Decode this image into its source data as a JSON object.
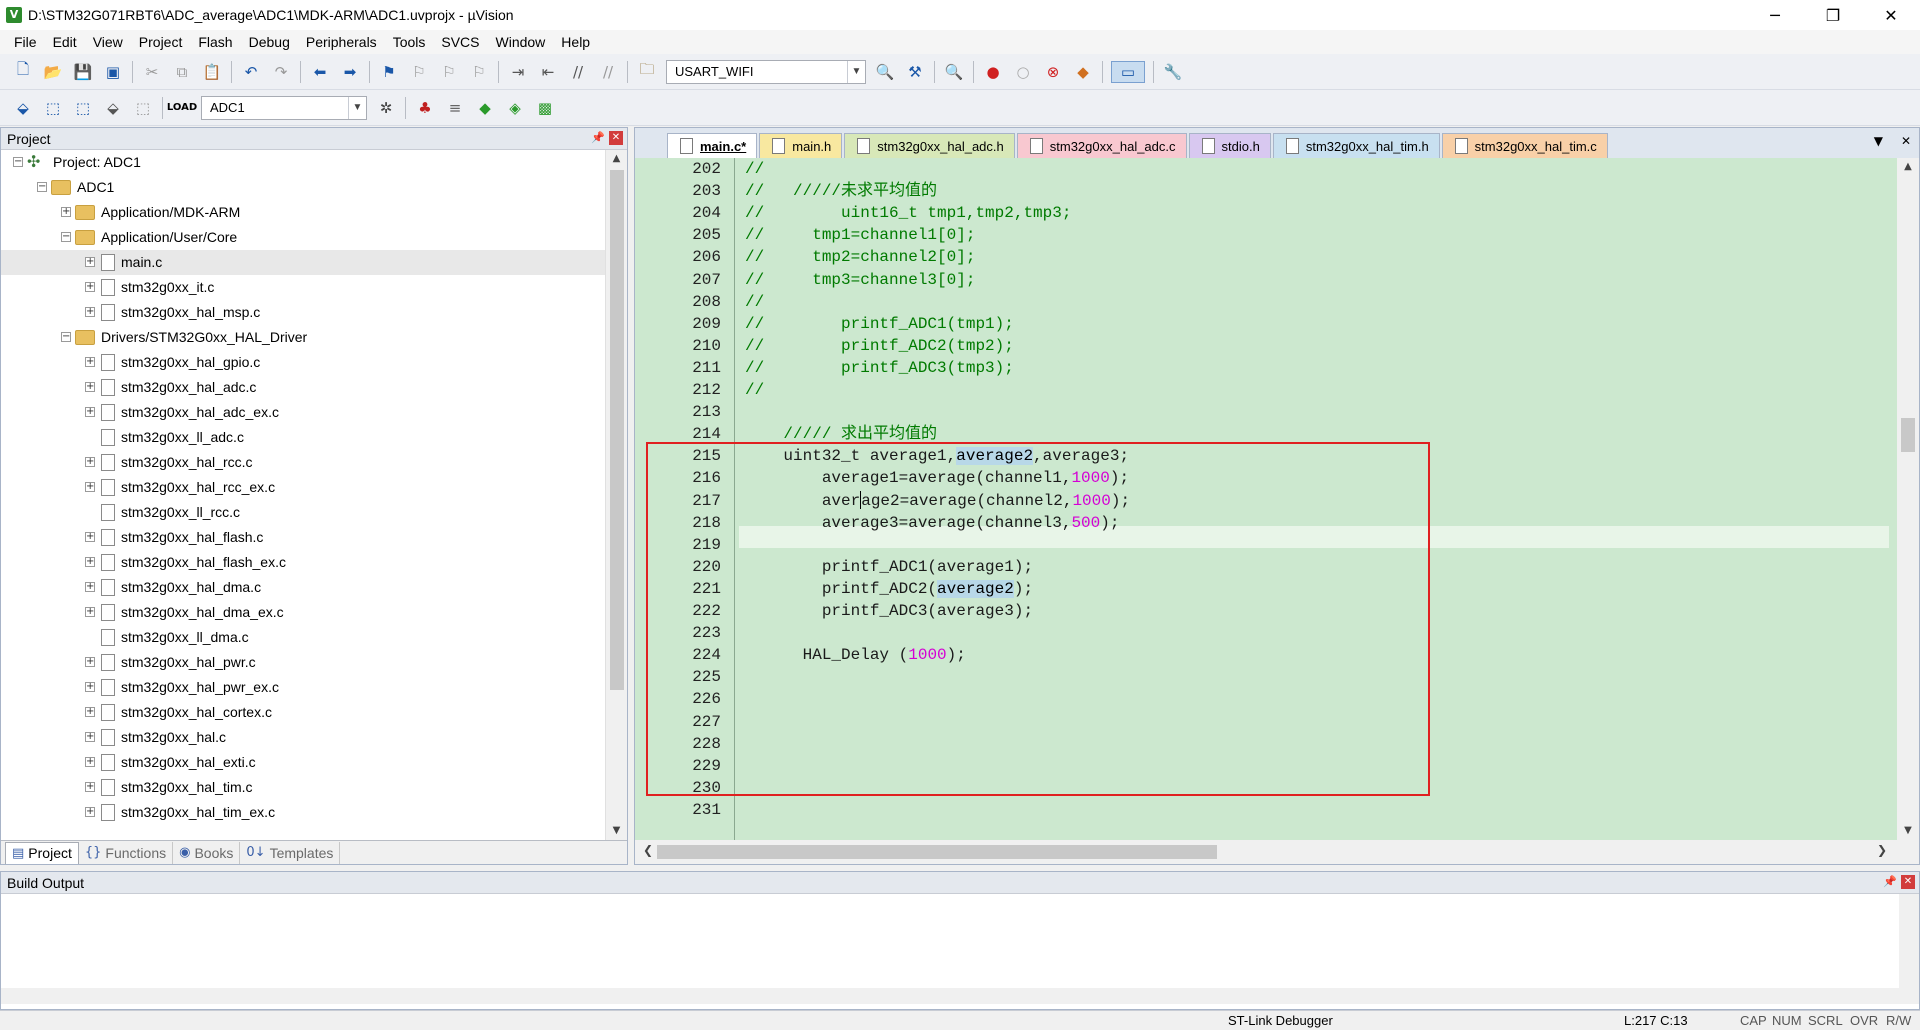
{
  "window": {
    "title": "D:\\STM32G071RBT6\\ADC_average\\ADC1\\MDK-ARM\\ADC1.uvprojx - µVision",
    "app_icon": "V"
  },
  "menu": [
    "File",
    "Edit",
    "View",
    "Project",
    "Flash",
    "Debug",
    "Peripherals",
    "Tools",
    "SVCS",
    "Window",
    "Help"
  ],
  "toolbar": {
    "find_combo": "USART_WIFI",
    "target_combo": "ADC1"
  },
  "project_panel": {
    "title": "Project",
    "tree": [
      {
        "label": "Project: ADC1",
        "level": 0,
        "type": "project",
        "expander": "−"
      },
      {
        "label": "ADC1",
        "level": 1,
        "type": "folder",
        "expander": "−"
      },
      {
        "label": "Application/MDK-ARM",
        "level": 2,
        "type": "folder",
        "expander": "+"
      },
      {
        "label": "Application/User/Core",
        "level": 2,
        "type": "folder",
        "expander": "−"
      },
      {
        "label": "main.c",
        "level": 3,
        "type": "file",
        "expander": "+",
        "selected": true
      },
      {
        "label": "stm32g0xx_it.c",
        "level": 3,
        "type": "file",
        "expander": "+"
      },
      {
        "label": "stm32g0xx_hal_msp.c",
        "level": 3,
        "type": "file",
        "expander": "+"
      },
      {
        "label": "Drivers/STM32G0xx_HAL_Driver",
        "level": 2,
        "type": "folder",
        "expander": "−"
      },
      {
        "label": "stm32g0xx_hal_gpio.c",
        "level": 3,
        "type": "file",
        "expander": "+"
      },
      {
        "label": "stm32g0xx_hal_adc.c",
        "level": 3,
        "type": "file",
        "expander": "+"
      },
      {
        "label": "stm32g0xx_hal_adc_ex.c",
        "level": 3,
        "type": "file",
        "expander": "+"
      },
      {
        "label": "stm32g0xx_ll_adc.c",
        "level": 3,
        "type": "file",
        "expander": ""
      },
      {
        "label": "stm32g0xx_hal_rcc.c",
        "level": 3,
        "type": "file",
        "expander": "+"
      },
      {
        "label": "stm32g0xx_hal_rcc_ex.c",
        "level": 3,
        "type": "file",
        "expander": "+"
      },
      {
        "label": "stm32g0xx_ll_rcc.c",
        "level": 3,
        "type": "file",
        "expander": ""
      },
      {
        "label": "stm32g0xx_hal_flash.c",
        "level": 3,
        "type": "file",
        "expander": "+"
      },
      {
        "label": "stm32g0xx_hal_flash_ex.c",
        "level": 3,
        "type": "file",
        "expander": "+"
      },
      {
        "label": "stm32g0xx_hal_dma.c",
        "level": 3,
        "type": "file",
        "expander": "+"
      },
      {
        "label": "stm32g0xx_hal_dma_ex.c",
        "level": 3,
        "type": "file",
        "expander": "+"
      },
      {
        "label": "stm32g0xx_ll_dma.c",
        "level": 3,
        "type": "file",
        "expander": ""
      },
      {
        "label": "stm32g0xx_hal_pwr.c",
        "level": 3,
        "type": "file",
        "expander": "+"
      },
      {
        "label": "stm32g0xx_hal_pwr_ex.c",
        "level": 3,
        "type": "file",
        "expander": "+"
      },
      {
        "label": "stm32g0xx_hal_cortex.c",
        "level": 3,
        "type": "file",
        "expander": "+"
      },
      {
        "label": "stm32g0xx_hal.c",
        "level": 3,
        "type": "file",
        "expander": "+"
      },
      {
        "label": "stm32g0xx_hal_exti.c",
        "level": 3,
        "type": "file",
        "expander": "+"
      },
      {
        "label": "stm32g0xx_hal_tim.c",
        "level": 3,
        "type": "file",
        "expander": "+"
      },
      {
        "label": "stm32g0xx_hal_tim_ex.c",
        "level": 3,
        "type": "file",
        "expander": "+"
      }
    ],
    "tabs": [
      {
        "label": "Project",
        "icon": "▤",
        "active": true
      },
      {
        "label": "Functions",
        "icon": "{}",
        "active": false
      },
      {
        "label": "Books",
        "icon": "◉",
        "active": false
      },
      {
        "label": "Templates",
        "icon": "0↓",
        "active": false
      }
    ]
  },
  "editor": {
    "tabs": [
      {
        "label": "main.c*",
        "active": true,
        "color": "#ffffff"
      },
      {
        "label": "main.h",
        "active": false,
        "color": "#f8e8a0"
      },
      {
        "label": "stm32g0xx_hal_adc.h",
        "active": false,
        "color": "#d8e8b8"
      },
      {
        "label": "stm32g0xx_hal_adc.c",
        "active": false,
        "color": "#f8c8d0"
      },
      {
        "label": "stdio.h",
        "active": false,
        "color": "#d8c8f0"
      },
      {
        "label": "stm32g0xx_hal_tim.h",
        "active": false,
        "color": "#c8e0f0"
      },
      {
        "label": "stm32g0xx_hal_tim.c",
        "active": false,
        "color": "#f8d0a8"
      }
    ],
    "lines": [
      {
        "n": "202",
        "segs": [
          [
            "cmt",
            "//"
          ]
        ]
      },
      {
        "n": "203",
        "segs": [
          [
            "cmt",
            "//   /////未求平均值的"
          ]
        ]
      },
      {
        "n": "204",
        "segs": [
          [
            "cmt",
            "//        uint16_t tmp1,tmp2,tmp3;"
          ]
        ]
      },
      {
        "n": "205",
        "segs": [
          [
            "cmt",
            "//     tmp1=channel1[0];"
          ]
        ]
      },
      {
        "n": "206",
        "segs": [
          [
            "cmt",
            "//     tmp2=channel2[0];"
          ]
        ]
      },
      {
        "n": "207",
        "segs": [
          [
            "cmt",
            "//     tmp3=channel3[0];"
          ]
        ]
      },
      {
        "n": "208",
        "segs": [
          [
            "cmt",
            "//"
          ]
        ]
      },
      {
        "n": "209",
        "segs": [
          [
            "cmt",
            "//        printf_ADC1(tmp1);"
          ]
        ]
      },
      {
        "n": "210",
        "segs": [
          [
            "cmt",
            "//        printf_ADC2(tmp2);"
          ]
        ]
      },
      {
        "n": "211",
        "segs": [
          [
            "cmt",
            "//        printf_ADC3(tmp3);"
          ]
        ]
      },
      {
        "n": "212",
        "segs": [
          [
            "cmt",
            "//"
          ]
        ]
      },
      {
        "n": "213",
        "segs": []
      },
      {
        "n": "214",
        "segs": [
          [
            "cmt",
            "    ///// 求出平均值的"
          ]
        ]
      },
      {
        "n": "215",
        "segs": [
          [
            "code",
            "    uint32_t average1,"
          ],
          [
            "hl",
            "average2"
          ],
          [
            "code",
            ",average3;"
          ]
        ]
      },
      {
        "n": "216",
        "segs": [
          [
            "code",
            "        average1=average(channel1,"
          ],
          [
            "num",
            "1000"
          ],
          [
            "code",
            ");"
          ]
        ]
      },
      {
        "n": "217",
        "segs": [
          [
            "code",
            "        aver"
          ],
          [
            "caret",
            ""
          ],
          [
            "code",
            "age2=average(channel2,"
          ],
          [
            "num",
            "1000"
          ],
          [
            "code",
            ");"
          ]
        ]
      },
      {
        "n": "218",
        "segs": [
          [
            "code",
            "        average3=average(channel3,"
          ],
          [
            "num",
            "500"
          ],
          [
            "code",
            ");"
          ]
        ]
      },
      {
        "n": "219",
        "segs": []
      },
      {
        "n": "220",
        "segs": [
          [
            "code",
            "        printf_ADC1(average1);"
          ]
        ]
      },
      {
        "n": "221",
        "segs": [
          [
            "code",
            "        printf_ADC2("
          ],
          [
            "hl",
            "average2"
          ],
          [
            "code",
            ");"
          ]
        ]
      },
      {
        "n": "222",
        "segs": [
          [
            "code",
            "        printf_ADC3(average3);"
          ]
        ]
      },
      {
        "n": "223",
        "segs": []
      },
      {
        "n": "224",
        "segs": [
          [
            "code",
            "      HAL_Delay ("
          ],
          [
            "num",
            "1000"
          ],
          [
            "code",
            ");"
          ]
        ]
      },
      {
        "n": "225",
        "segs": []
      },
      {
        "n": "226",
        "segs": []
      },
      {
        "n": "227",
        "segs": []
      },
      {
        "n": "228",
        "segs": []
      },
      {
        "n": "229",
        "segs": []
      },
      {
        "n": "230",
        "segs": []
      },
      {
        "n": "231",
        "segs": []
      }
    ]
  },
  "build_output": {
    "title": "Build Output"
  },
  "status": {
    "debugger": "ST-Link Debugger",
    "position": "L:217 C:13",
    "indicators": [
      "CAP",
      "NUM",
      "SCRL",
      "OVR",
      "R/W"
    ]
  },
  "colors": {
    "editor_bg": "#cce8cf",
    "comment": "#007a00",
    "number": "#d400d4",
    "annotation_box": "#e02020"
  }
}
